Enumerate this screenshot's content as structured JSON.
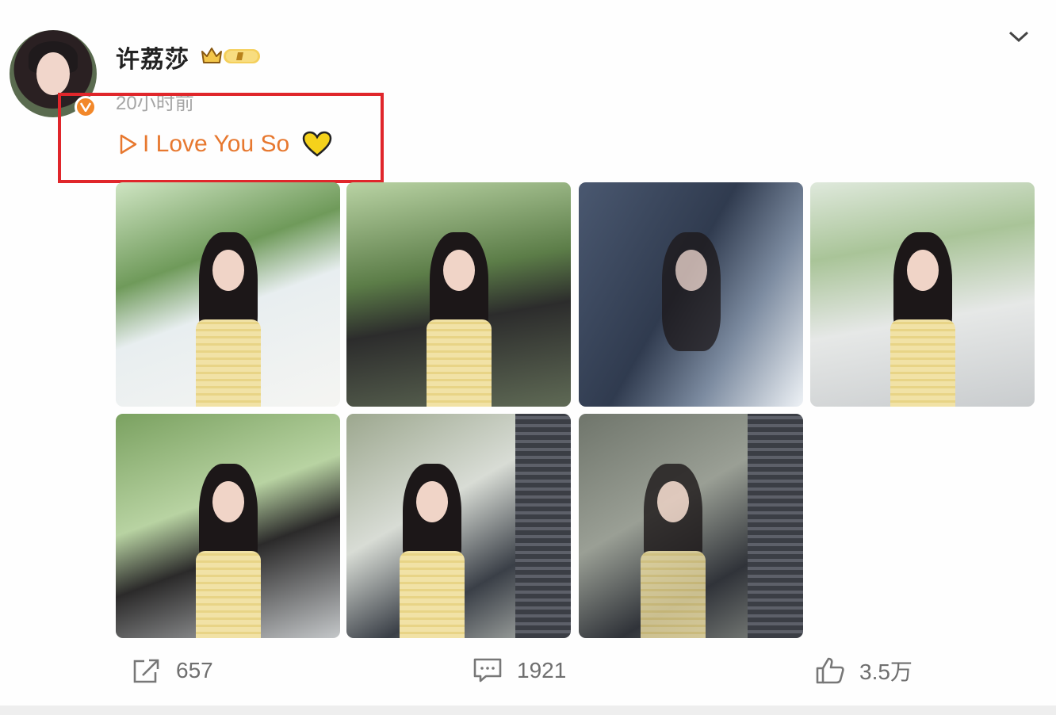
{
  "post": {
    "username": "许荔莎",
    "time": "20小时前",
    "song_title": "I Love You So",
    "accent_color": "#e7782f",
    "highlight_color": "#e0262b",
    "icons": [
      "verified-icon",
      "crown-badge-icon",
      "chevron-down-icon",
      "play-icon",
      "yellow-heart-icon"
    ]
  },
  "photos": [
    {
      "name": "photo-1"
    },
    {
      "name": "photo-2"
    },
    {
      "name": "photo-3"
    },
    {
      "name": "photo-4"
    },
    {
      "name": "photo-5"
    },
    {
      "name": "photo-6"
    },
    {
      "name": "photo-7"
    }
  ],
  "actions": {
    "share_count": "657",
    "comment_count": "1921",
    "like_count": "3.5万"
  }
}
